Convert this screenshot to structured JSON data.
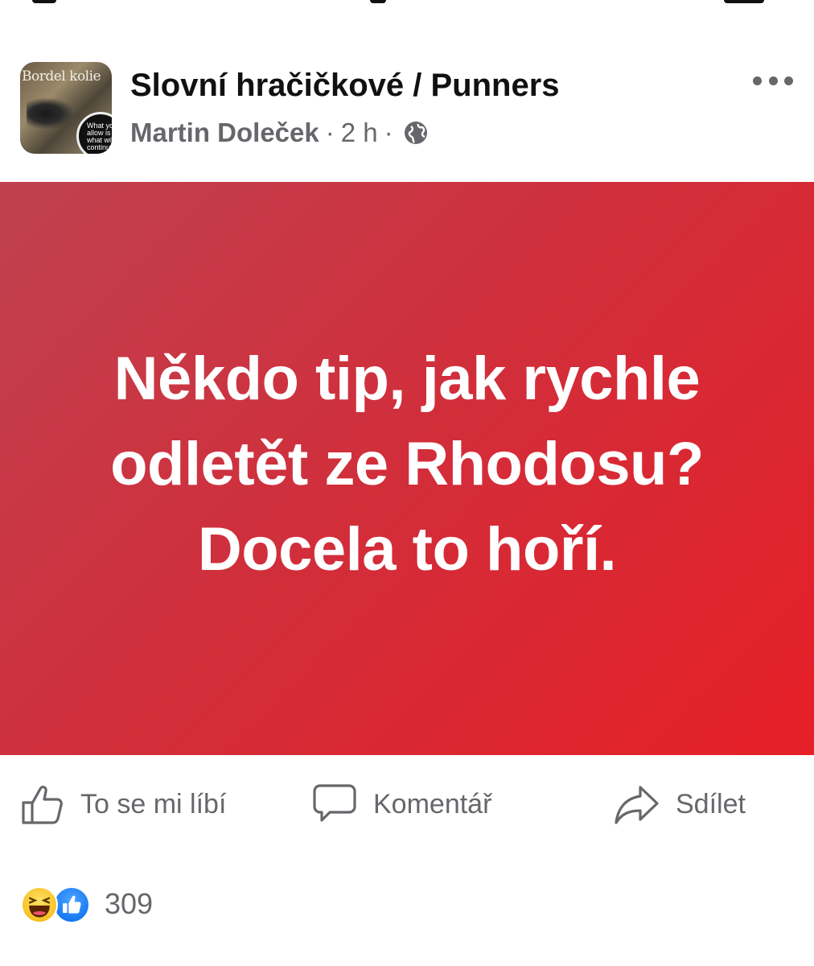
{
  "post": {
    "page_title": "Slovní hračičkové / Punners",
    "author": "Martin Doleček",
    "time_ago": "2 h",
    "separator": "·",
    "privacy_icon": "globe-icon",
    "more_icon": "more-options-icon",
    "avatar": {
      "title_text": "Bordel kolie",
      "circle_text": "What you allow is what will continue"
    },
    "body_lines": [
      "Někdo tip, jak rychle",
      "odletět ze Rhodosu?",
      "Docela to hoří."
    ],
    "background_colors": [
      "#c0414f",
      "#e61f27"
    ]
  },
  "actions": {
    "like_label": "To se mi líbí",
    "comment_label": "Komentář",
    "share_label": "Sdílet"
  },
  "reactions": {
    "icons": [
      "haha-icon",
      "like-icon"
    ],
    "count": "309"
  }
}
